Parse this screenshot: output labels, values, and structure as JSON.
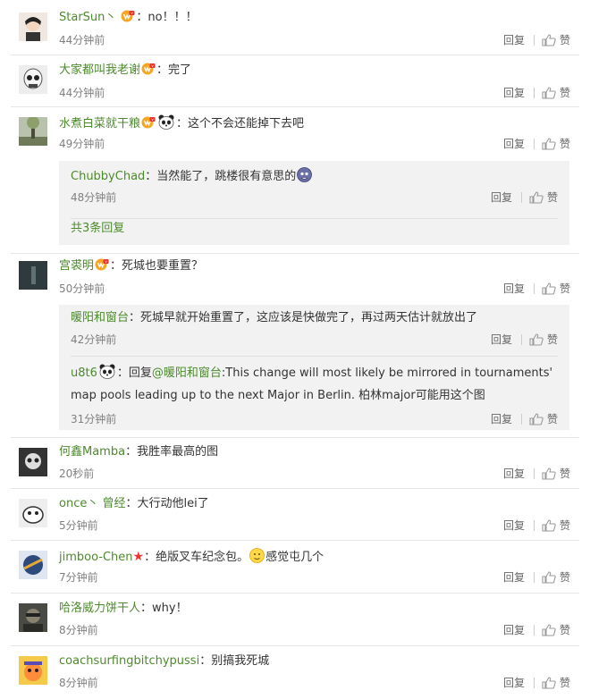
{
  "action_labels": {
    "reply": "回复",
    "like": "赞"
  },
  "comments": [
    {
      "user": "StarSun丶",
      "text": "：no！！！",
      "time": "44分钟前"
    },
    {
      "user": "大家都叫我老谢",
      "text": "：完了",
      "time": "44分钟前"
    },
    {
      "user": "水煮白菜就干粮",
      "text": "：这个不会还能掉下去吧",
      "time": "49分钟前",
      "replies": [
        {
          "user": "ChubbyChad",
          "text": "：当然能了，跳楼很有意思的",
          "time": "48分钟前"
        }
      ],
      "more": "共3条回复"
    },
    {
      "user": "宫裘明",
      "text": "：死城也要重置？",
      "time": "50分钟前",
      "replies": [
        {
          "user": "暖阳和窗台",
          "text": "：死城早就开始重置了，这应该是快做完了，再过两天估计就放出了",
          "time": "42分钟前"
        },
        {
          "user": "u8t6",
          "text_prefix": "：回复",
          "mention": "@暖阳和窗台",
          "text": ":This change will most likely be mirrored in tournaments' map pools leading up to the next Major in Berlin. 柏林major可能用这个图",
          "time": "31分钟前"
        }
      ]
    },
    {
      "user": "何鑫Mamba",
      "text": "：我胜率最高的图",
      "time": "20秒前"
    },
    {
      "user": "once丶 曾经",
      "text": "：大行动他lei了",
      "time": "5分钟前"
    },
    {
      "user": "jimboo-Chen",
      "text": "：绝版叉车纪念包。",
      "text2": "感觉屯几个",
      "time": "7分钟前"
    },
    {
      "user": "哈洛威力饼干人",
      "text": "：why！",
      "time": "8分钟前"
    },
    {
      "user": "coachsurfingbitchypussi",
      "text": "：别搞我死城",
      "time": "8分钟前"
    }
  ],
  "colors": {
    "username": "#4c8a2c",
    "reply_box": "#f2f2f2",
    "time": "#808080"
  },
  "icons": [
    "thumbs-up-icon",
    "vip-badge-icon",
    "panda-icon",
    "emoji-face-icon",
    "red-star-icon"
  ]
}
